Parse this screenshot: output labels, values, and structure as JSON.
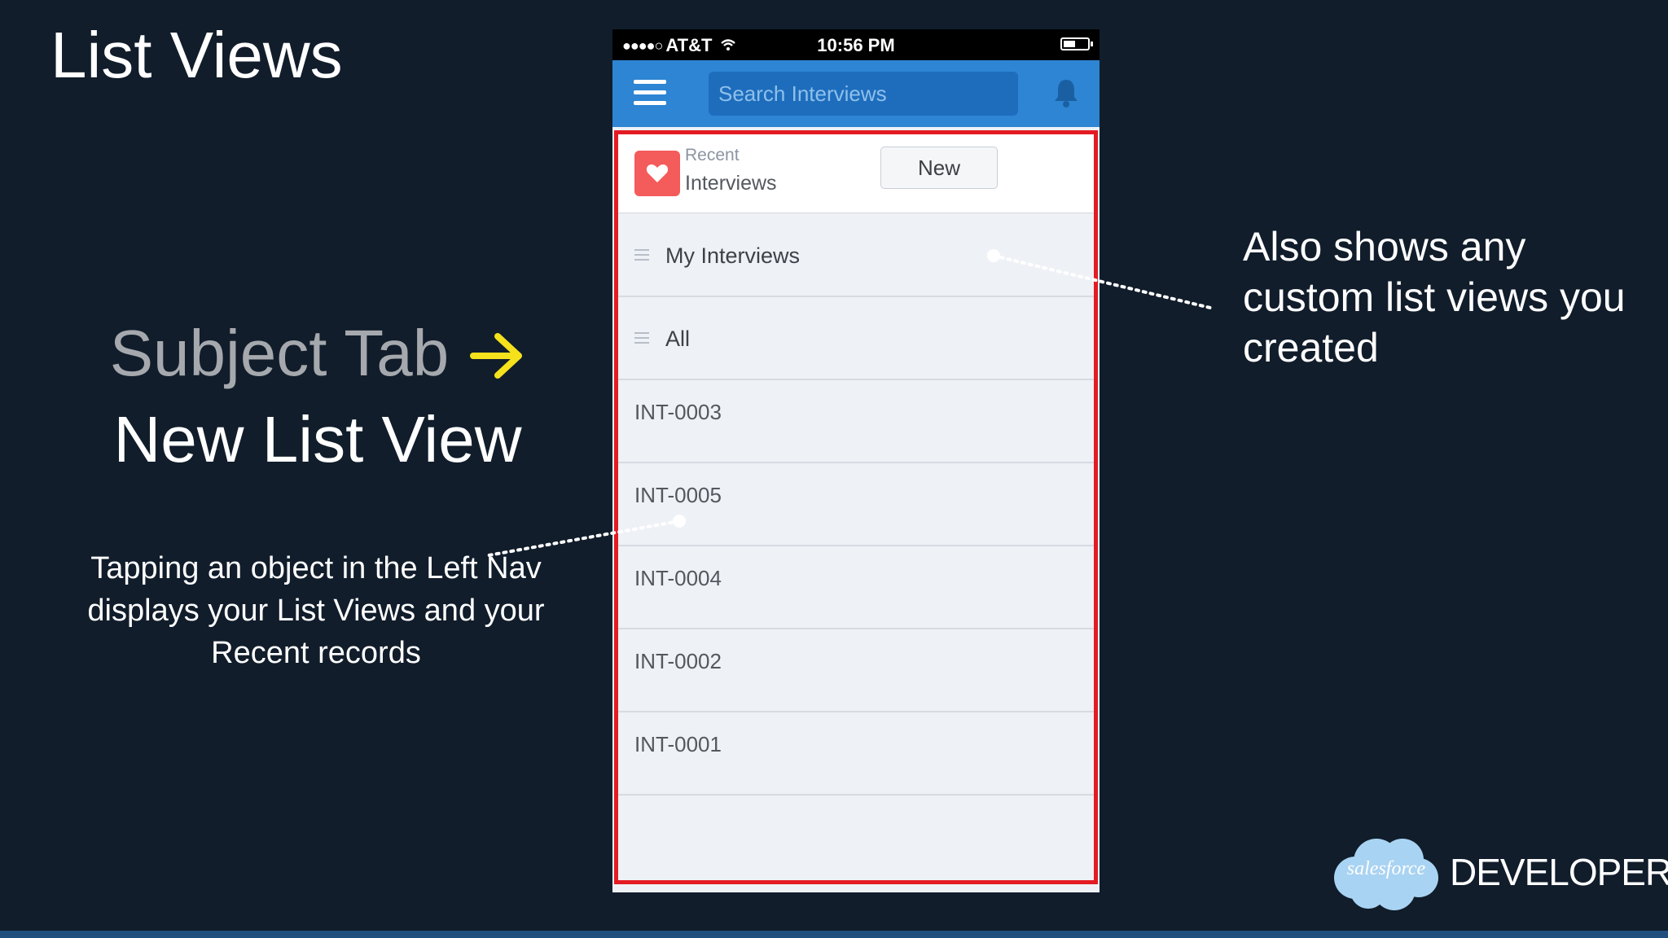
{
  "slide": {
    "title": "List Views",
    "subject_tab": "Subject Tab",
    "new_list_view": "New List View",
    "left_note": "Tapping an object in the Left Nav displays your List Views and your Recent records",
    "right_note": "Also shows any custom list views you created",
    "accent_color": "#f5e11c",
    "brand_text": "DEVELOPERS",
    "logo_text": "salesforce"
  },
  "phone": {
    "status_bar": {
      "carrier": "AT&T",
      "signal": "●●●●○",
      "time": "10:56 PM",
      "battery_level": 0.45
    },
    "header": {
      "search_placeholder": "Search Interviews",
      "menu_icon": "hamburger-icon",
      "bell_icon": "bell-icon",
      "color": "#2d85d3"
    },
    "object": {
      "recent_label": "Recent",
      "name": "Interviews",
      "new_button": "New",
      "icon": "heart-icon",
      "icon_color": "#f45b5b"
    },
    "list_views": [
      {
        "label": "My Interviews",
        "icon": "list-icon"
      },
      {
        "label": "All",
        "icon": "list-icon"
      }
    ],
    "records": [
      "INT-0003",
      "INT-0005",
      "INT-0004",
      "INT-0002",
      "INT-0001"
    ],
    "highlight_color": "#e31b23"
  }
}
